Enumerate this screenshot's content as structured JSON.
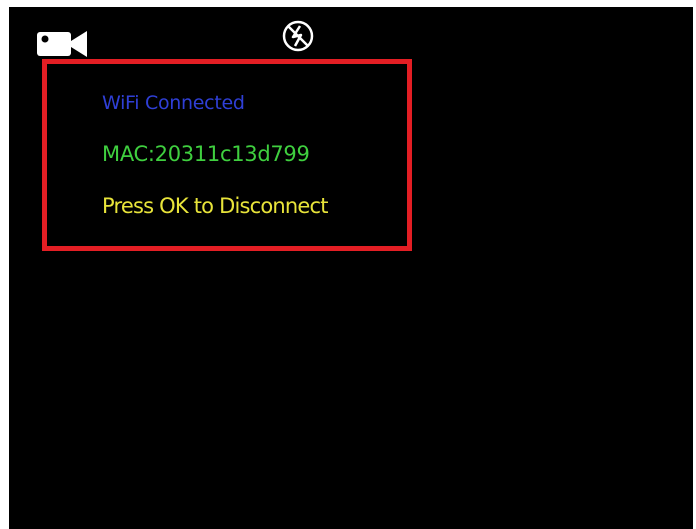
{
  "status_bar": {
    "mode_icon": "video-camera-icon",
    "flash_icon": "flash-off-icon"
  },
  "wifi_panel": {
    "status": "WiFi Connected",
    "mac": "MAC:20311c13d799",
    "instruction": "Press OK to Disconnect"
  },
  "colors": {
    "status": "#2f3fd6",
    "mac": "#3fcf3f",
    "instruction": "#e8e43a",
    "highlight": "#e31e24",
    "background": "#000000"
  }
}
